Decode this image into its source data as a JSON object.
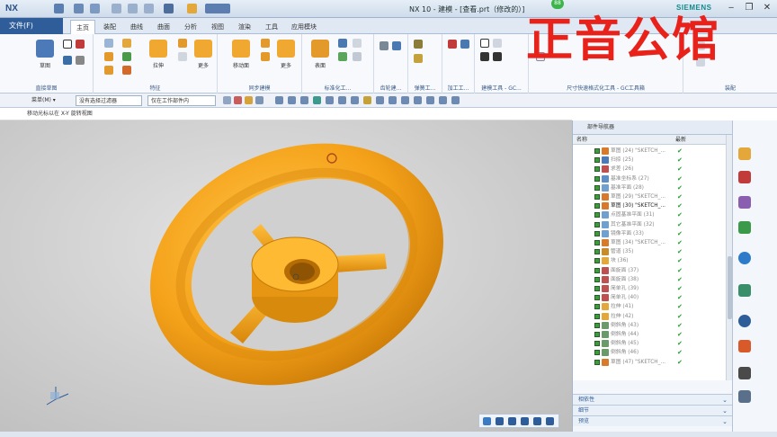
{
  "app": {
    "logo": "NX",
    "window_title": "NX 10 - 建模 - [查看.prt（修改的）]",
    "vendor": "SIEMENS",
    "badge": "88"
  },
  "tabs": [
    {
      "label": "文件(F)"
    },
    {
      "label": "主页"
    },
    {
      "label": "装配"
    },
    {
      "label": "曲线"
    },
    {
      "label": "曲面"
    },
    {
      "label": "分析"
    },
    {
      "label": "视图"
    },
    {
      "label": "渲染"
    },
    {
      "label": "工具"
    },
    {
      "label": "应用模块"
    }
  ],
  "ribbon": {
    "groups": [
      {
        "label": "直接草图"
      },
      {
        "label": "特征"
      },
      {
        "label": "同步建模"
      },
      {
        "label": "标准化工..."
      },
      {
        "label": "齿轮建..."
      },
      {
        "label": "弹簧工..."
      },
      {
        "label": "加工工..."
      },
      {
        "label": "建模工具 - GC..."
      },
      {
        "label": "尺寸快速格式化工具 - GC工具箱"
      },
      {
        "label": "装配"
      }
    ],
    "buttons": {
      "sketch": "草图",
      "extrude": "拉伸",
      "unite": "合并",
      "more1": "更多",
      "move_face": "移动面",
      "more2": "更多",
      "feature_set": "表面",
      "more3": "更多"
    }
  },
  "toolbar2": {
    "menu_label": "菜单(M) ▾",
    "filter": "没有选择过滤器",
    "scope": "仅在工作部件内"
  },
  "status_text": "移动光标以在 X-Y 旋转视图",
  "watermark": "正音公馆",
  "navigator": {
    "title": "部件导航器",
    "col_name": "名称",
    "col_latest": "最新",
    "rows": [
      {
        "name": "草图 (24) \"SKETCH_...",
        "ok": "✔"
      },
      {
        "name": "扫掠 (25)",
        "ok": "✔"
      },
      {
        "name": "求差 (26)",
        "ok": "✔"
      },
      {
        "name": "基准坐标系 (27)",
        "ok": "✔"
      },
      {
        "name": "基准平面 (28)",
        "ok": "✔"
      },
      {
        "name": "草图 (29) \"SKETCH_...",
        "ok": "✔"
      },
      {
        "name": "草图 (30) \"SKETCH_...",
        "ok": "✔"
      },
      {
        "name": "点固基准平面 (31)",
        "ok": "✔"
      },
      {
        "name": "其它基准平面 (32)",
        "ok": "✔"
      },
      {
        "name": "镜像平面 (33)",
        "ok": "✔"
      },
      {
        "name": "草图 (34) \"SKETCH_...",
        "ok": "✔"
      },
      {
        "name": "管道 (35)",
        "ok": "✔"
      },
      {
        "name": "块 (36)",
        "ok": "✔"
      },
      {
        "name": "面旋面 (37)",
        "ok": "✔"
      },
      {
        "name": "面旋面 (38)",
        "ok": "✔"
      },
      {
        "name": "简单孔 (39)",
        "ok": "✔"
      },
      {
        "name": "简单孔 (40)",
        "ok": "✔"
      },
      {
        "name": "拉伸 (41)",
        "ok": "✔"
      },
      {
        "name": "拉伸 (42)",
        "ok": "✔"
      },
      {
        "name": "倒斜角 (43)",
        "ok": "✔"
      },
      {
        "name": "倒斜角 (44)",
        "ok": "✔"
      },
      {
        "name": "倒斜角 (45)",
        "ok": "✔"
      },
      {
        "name": "倒斜角 (46)",
        "ok": "✔"
      },
      {
        "name": "草图 (47) \"SKETCH_...",
        "ok": "✔"
      }
    ],
    "sections": [
      {
        "label": "相依性"
      },
      {
        "label": "细节"
      },
      {
        "label": "预览"
      }
    ]
  },
  "colors": {
    "accent": "#2e5d99",
    "part": "#f5a21a",
    "watermark": "#e8221b"
  }
}
